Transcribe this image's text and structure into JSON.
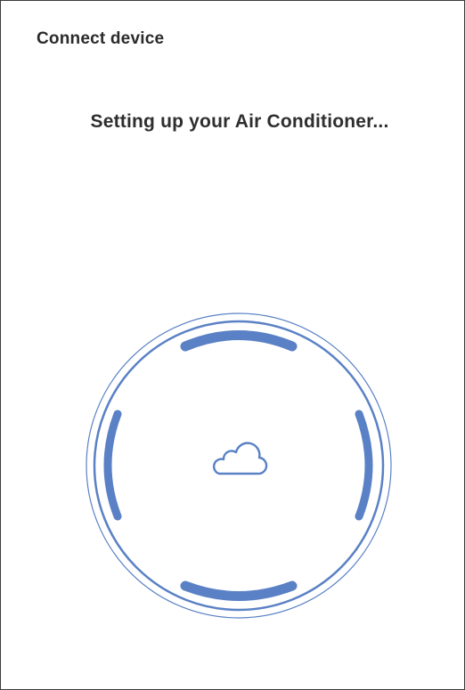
{
  "header": {
    "title": "Connect device"
  },
  "main": {
    "status_text": "Setting up your Air Conditioner...",
    "progress_icon": "cloud-icon"
  },
  "colors": {
    "accent": "#5a81c5",
    "text": "#2e2e2e",
    "frame": "#3c3c3c"
  }
}
